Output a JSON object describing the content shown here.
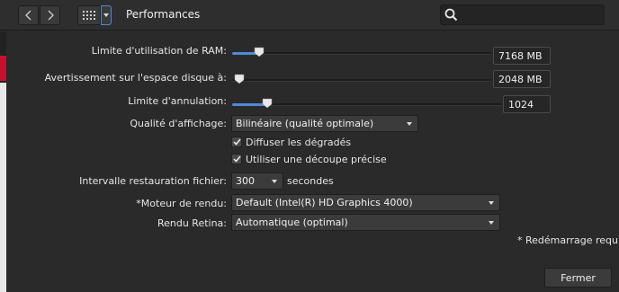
{
  "toolbar": {
    "back_icon": "chevron-left-icon",
    "forward_icon": "chevron-right-icon",
    "grid_icon": "grid-icon",
    "title": "Performances",
    "search_placeholder": "",
    "search_icon": "search-icon"
  },
  "settings": {
    "ram_limit": {
      "label": "Limite d'utilisation de RAM:",
      "value": "7168 MB",
      "level": 0.08
    },
    "disk_warning": {
      "label": "Avertissement sur l'espace disque à:",
      "value": "2048 MB",
      "level": 0.0
    },
    "undo_limit": {
      "label": "Limite d'annulation:",
      "value": "1024",
      "level": 0.12
    },
    "display_quality": {
      "label": "Qualité d'affichage:",
      "value": "Bilinéaire (qualité optimale)"
    },
    "dither_gradients": {
      "label": "Diffuser les dégradés",
      "checked": true
    },
    "precise_clipping": {
      "label": "Utiliser une découpe précise",
      "checked": true
    },
    "file_recovery": {
      "label": "Intervalle restauration fichier:",
      "value": "300",
      "unit": "secondes"
    },
    "render_engine": {
      "label": "*Moteur de rendu:",
      "value": "Default (Intel(R) HD Graphics 4000)"
    },
    "retina_render": {
      "label": "Rendu Retina:",
      "value": "Automatique (optimal)"
    }
  },
  "note": "* Redémarrage requis",
  "close_label": "Fermer",
  "colors": {
    "accent": "#4e8bd5",
    "background": "#2a2a2a"
  }
}
